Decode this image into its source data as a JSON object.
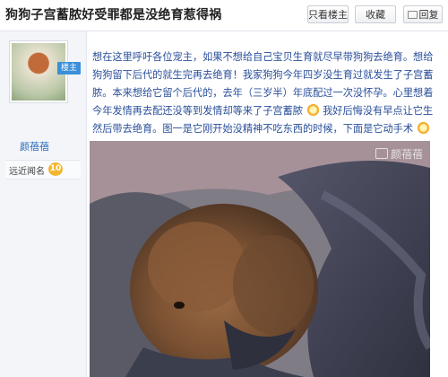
{
  "header": {
    "title": "狗狗子宫蓄脓好受罪都是没绝育惹得祸",
    "buttons": {
      "only_author": "只看楼主",
      "favorite": "收藏",
      "reply": "回复"
    }
  },
  "author": {
    "badge": "楼主",
    "username": "颜蓓蓓",
    "level_label": "远近闻名",
    "level": "10"
  },
  "post": {
    "text_1": "想在这里呼吁各位宠主，如果不想给自己宝贝生育就尽早带狗狗去绝育。想给狗狗留下后代的就生完再去绝育！我家狗狗今年四岁没生育过就发生了子宫蓄脓。本来想给它留个后代的，去年（三岁半）年底配过一次没怀孕。心里想着今年发情再去配还没等到发情却等来了子宫蓄脓",
    "text_2": "我好后悔没有早点让它生然后带去绝育。图一是它刚开始没精神不吃东西的时候，下面是它动手术",
    "watermark": "颜蓓蓓"
  },
  "colors": {
    "link_blue": "#2a4f9a",
    "username_blue": "#2b6ab8",
    "badge_blue": "#3b8fd8",
    "level_gold": "#f2b632"
  },
  "icons": [
    "reply-icon",
    "smiley-emoticon-icon",
    "camera-watermark-icon"
  ]
}
